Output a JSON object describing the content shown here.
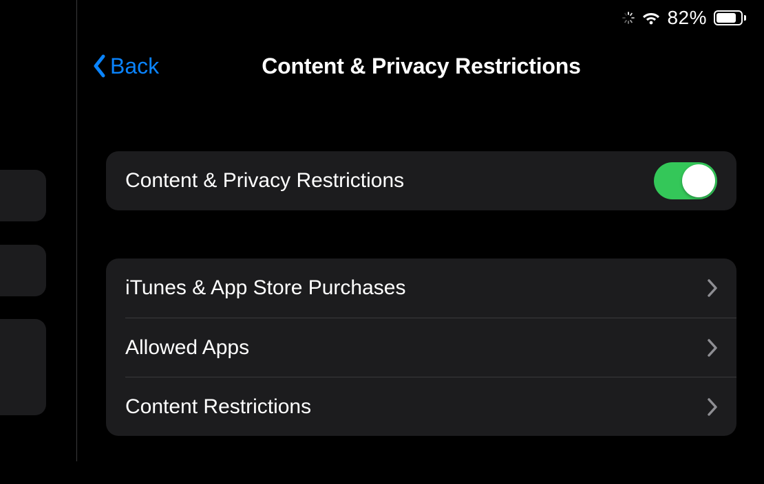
{
  "status": {
    "battery_pct": "82%",
    "battery_fill": 82
  },
  "nav": {
    "back_label": "Back",
    "title": "Content & Privacy Restrictions"
  },
  "group1": {
    "toggle_label": "Content & Privacy Restrictions",
    "toggle_on": true
  },
  "group2": {
    "items": [
      {
        "label": "iTunes & App Store Purchases"
      },
      {
        "label": "Allowed Apps"
      },
      {
        "label": "Content Restrictions"
      }
    ]
  },
  "colors": {
    "accent_blue": "#0a84ff",
    "switch_green": "#34c759",
    "cell_bg": "#1c1c1e",
    "separator": "#3a3a3c",
    "chevron_grey": "#8e8e93"
  }
}
